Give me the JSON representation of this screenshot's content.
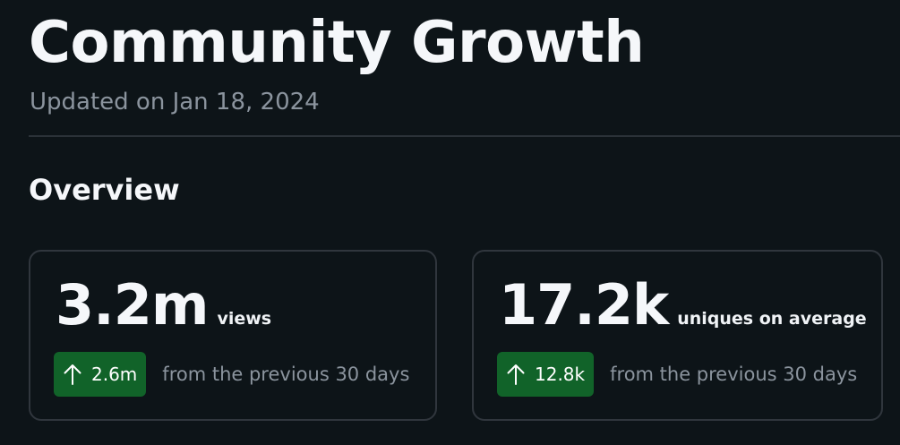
{
  "header": {
    "title": "Community Growth",
    "updated": "Updated on Jan 18, 2024"
  },
  "overview": {
    "heading": "Overview",
    "cards": [
      {
        "value": "3.2m",
        "label": "views",
        "change": {
          "icon": "arrow-up-icon",
          "value": "2.6m",
          "context": "from the previous 30 days"
        }
      },
      {
        "value": "17.2k",
        "label": "uniques on average",
        "change": {
          "icon": "arrow-up-icon",
          "value": "12.8k",
          "context": "from the previous 30 days"
        }
      }
    ]
  },
  "colors": {
    "background": "#0d1418",
    "positive_badge": "#116329",
    "muted_text": "#8b949e",
    "card_border": "#30363d"
  }
}
